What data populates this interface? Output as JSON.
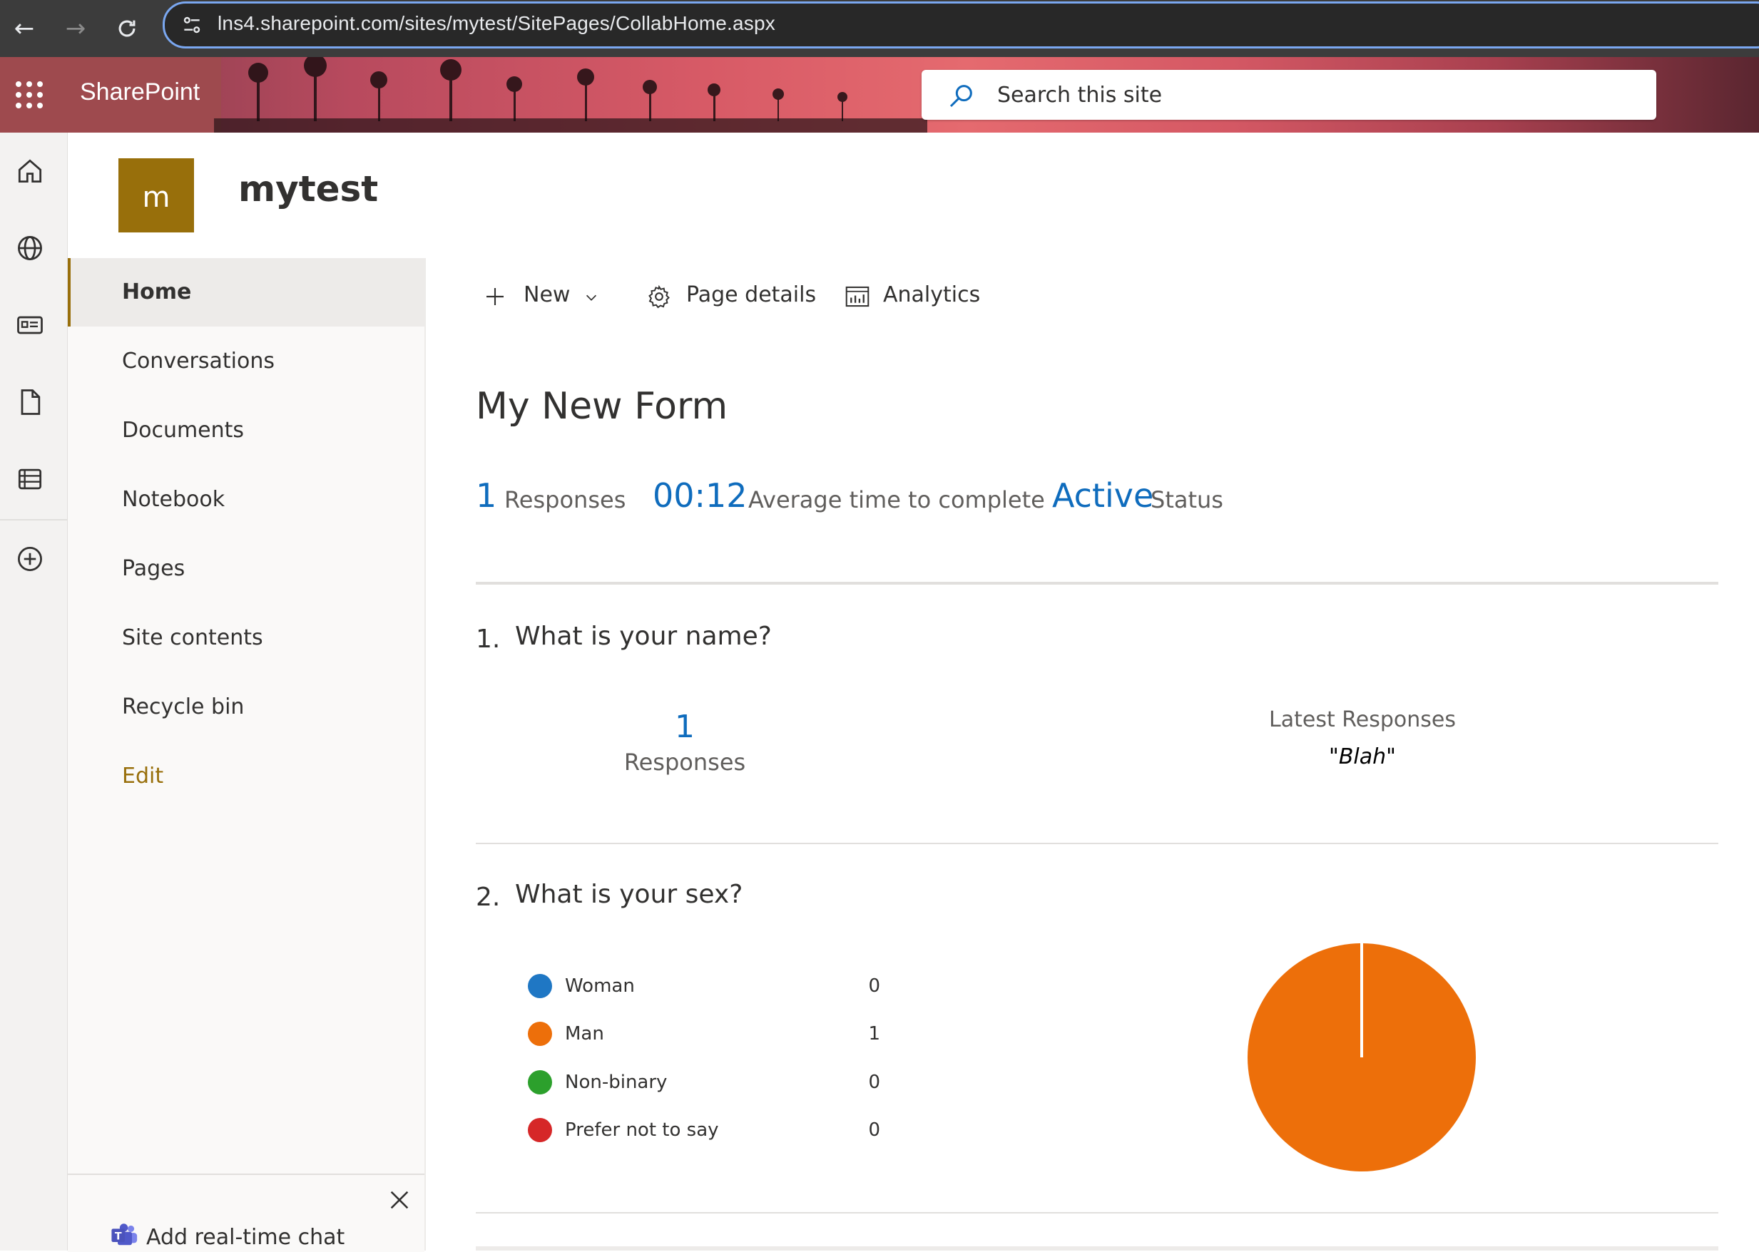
{
  "browser": {
    "url": "lns4.sharepoint.com/sites/mytest/SitePages/CollabHome.aspx"
  },
  "suite": {
    "app_name": "SharePoint",
    "search_placeholder": "Search this site"
  },
  "site": {
    "logo_letter": "m",
    "title": "mytest",
    "logo_color": "#986f0b"
  },
  "left_nav": {
    "items": [
      {
        "label": "Home",
        "selected": true
      },
      {
        "label": "Conversations"
      },
      {
        "label": "Documents"
      },
      {
        "label": "Notebook"
      },
      {
        "label": "Pages"
      },
      {
        "label": "Site contents"
      },
      {
        "label": "Recycle bin"
      },
      {
        "label": "Edit"
      }
    ]
  },
  "chat": {
    "label": "Add real-time chat"
  },
  "command_bar": {
    "new_label": "New",
    "page_details_label": "Page details",
    "analytics_label": "Analytics"
  },
  "form": {
    "title": "My New Form",
    "stats": {
      "responses_value": "1",
      "responses_label": "Responses",
      "avg_time_value": "00:12",
      "avg_time_label": "Average time to complete",
      "status_value": "Active",
      "status_label": "Status"
    },
    "questions": [
      {
        "number": "1.",
        "text": "What is your name?",
        "response_count": "1",
        "response_label": "Responses",
        "latest_label": "Latest Responses",
        "latest_value": "\"Blah\""
      },
      {
        "number": "2.",
        "text": "What is your sex?",
        "options": [
          {
            "label": "Woman",
            "count": "0",
            "color": "#1f77c4"
          },
          {
            "label": "Man",
            "count": "1",
            "color": "#ed6f0a"
          },
          {
            "label": "Non-binary",
            "count": "0",
            "color": "#2ca02c"
          },
          {
            "label": "Prefer not to say",
            "count": "0",
            "color": "#d62728"
          }
        ]
      }
    ]
  },
  "colors": {
    "accent_blue": "#0f6cbd",
    "theme_gold": "#986f0b",
    "pie_orange": "#ed6f0a"
  },
  "chart_data": {
    "type": "pie",
    "categories": [
      "Woman",
      "Man",
      "Non-binary",
      "Prefer not to say"
    ],
    "values": [
      0,
      1,
      0,
      0
    ],
    "colors": [
      "#1f77c4",
      "#ed6f0a",
      "#2ca02c",
      "#d62728"
    ]
  }
}
